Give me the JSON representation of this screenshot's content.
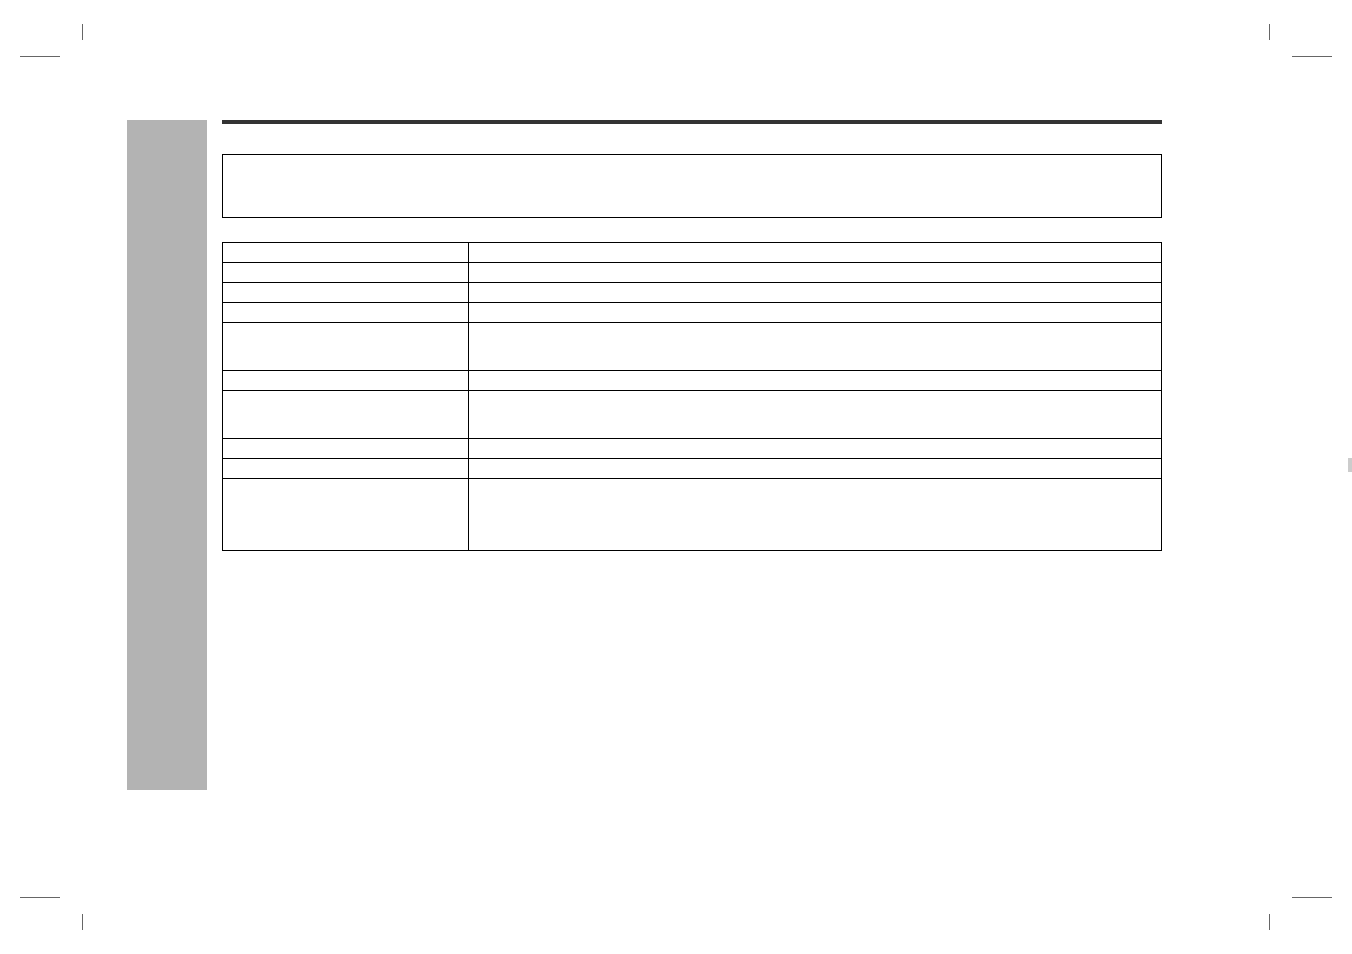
{
  "title": "",
  "table": {
    "rows": [
      {
        "c0": "",
        "c1": "",
        "h": "row-h1"
      },
      {
        "c0": "",
        "c1": "",
        "h": "row-h1"
      },
      {
        "c0": "",
        "c1": "",
        "h": "row-h1"
      },
      {
        "c0": "",
        "c1": "",
        "h": "row-h1"
      },
      {
        "c0": "",
        "c1": "",
        "h": "row-h2"
      },
      {
        "c0": "",
        "c1": "",
        "h": "row-h1"
      },
      {
        "c0": "",
        "c1": "",
        "h": "row-h2"
      },
      {
        "c0": "",
        "c1": "",
        "h": "row-h1"
      },
      {
        "c0": "",
        "c1": "",
        "h": "row-h1"
      },
      {
        "c0": "",
        "c1": "",
        "h": "row-h3"
      }
    ]
  }
}
